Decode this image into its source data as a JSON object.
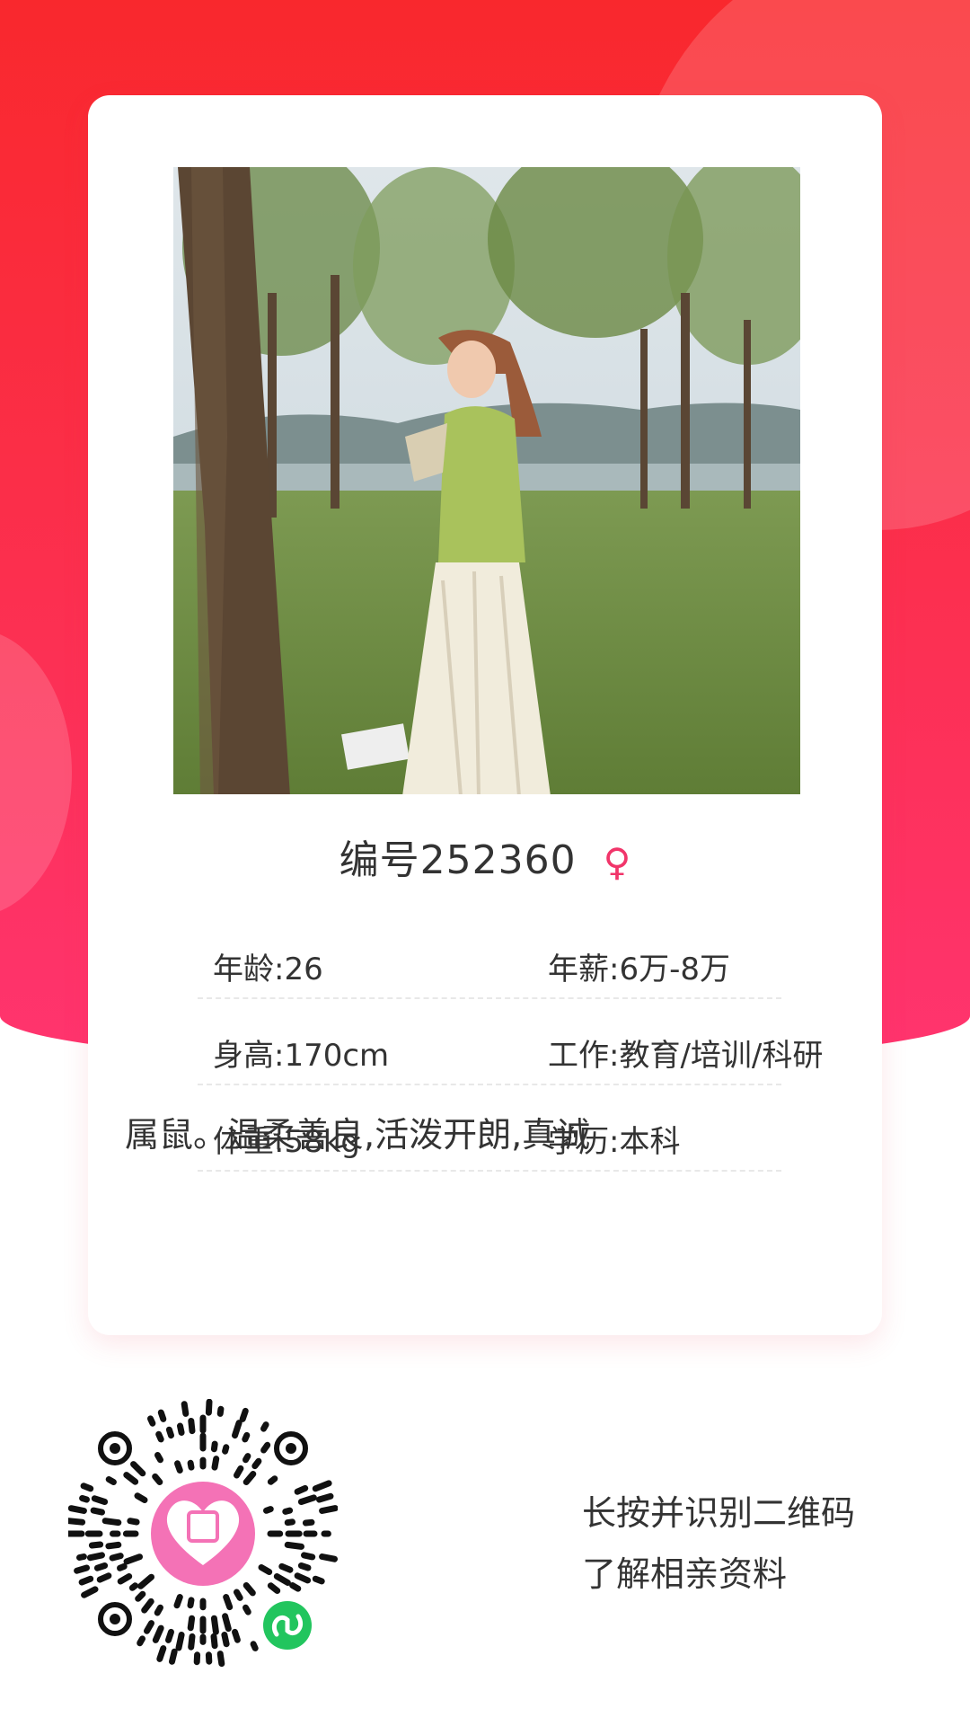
{
  "profile": {
    "number_title": "编号252360",
    "gender_symbol": "♀",
    "fields": [
      {
        "left": "年龄:26",
        "right": "年薪:6万-8万"
      },
      {
        "left": "身高:170cm",
        "right": "工作:教育/培训/科研"
      },
      {
        "left": "体重:58kg",
        "right": "学历:本科"
      }
    ],
    "description": "属鼠。温柔善良,活泼开朗,真诚"
  },
  "footer": {
    "line1": "长按并识别二维码",
    "line2": "了解相亲资料"
  },
  "colors": {
    "accent": "#f1356a",
    "background_top": "#f9282d",
    "background_bottom": "#ff346f",
    "qr_logo": "#f472b6",
    "mini_program_badge": "#22c55e"
  },
  "icons": [
    "female-icon",
    "qr-code",
    "mini-program-icon",
    "heart-logo-icon"
  ]
}
